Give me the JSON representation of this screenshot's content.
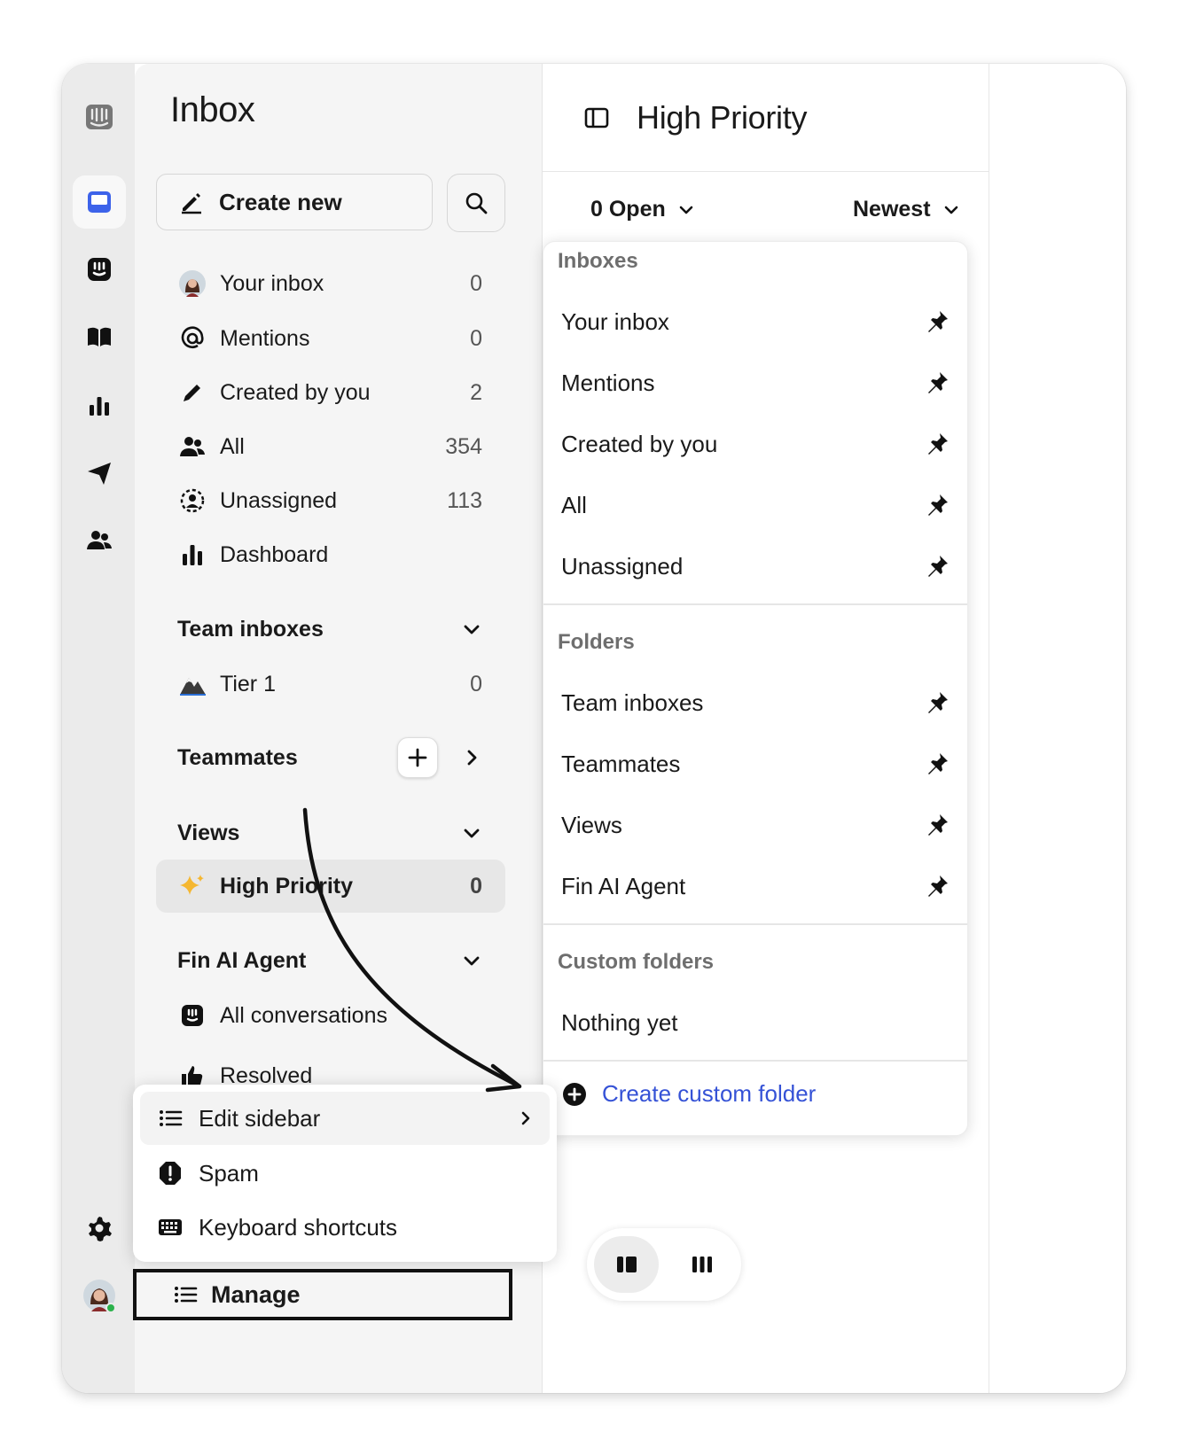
{
  "sidebar": {
    "title": "Inbox",
    "create_label": "Create new",
    "items": [
      {
        "label": "Your inbox",
        "count": "0"
      },
      {
        "label": "Mentions",
        "count": "0"
      },
      {
        "label": "Created by you",
        "count": "2"
      },
      {
        "label": "All",
        "count": "354"
      },
      {
        "label": "Unassigned",
        "count": "113"
      },
      {
        "label": "Dashboard",
        "count": ""
      }
    ],
    "team_inboxes": {
      "title": "Team inboxes",
      "items": [
        {
          "label": "Tier 1",
          "count": "0"
        }
      ]
    },
    "teammates": {
      "title": "Teammates"
    },
    "views": {
      "title": "Views",
      "items": [
        {
          "label": "High Priority",
          "count": "0"
        }
      ]
    },
    "fin": {
      "title": "Fin AI Agent",
      "items": [
        {
          "label": "All conversations"
        },
        {
          "label": "Resolved"
        }
      ]
    }
  },
  "manage_menu": {
    "items": [
      {
        "label": "Edit sidebar",
        "icon": "list-icon"
      },
      {
        "label": "Spam",
        "icon": "spam-icon"
      },
      {
        "label": "Keyboard shortcuts",
        "icon": "keyboard-icon"
      }
    ],
    "manage_label": "Manage"
  },
  "main": {
    "title": "High Priority",
    "status_filter": "0 Open",
    "sort_filter": "Newest"
  },
  "dropdown": {
    "inboxes_header": "Inboxes",
    "inboxes": [
      "Your inbox",
      "Mentions",
      "Created by you",
      "All",
      "Unassigned"
    ],
    "folders_header": "Folders",
    "folders": [
      "Team inboxes",
      "Teammates",
      "Views",
      "Fin AI Agent"
    ],
    "custom_header": "Custom folders",
    "custom_empty": "Nothing yet",
    "create_label": "Create custom folder"
  },
  "colors": {
    "accent": "#3552d6",
    "rail_active": "#3d63ea",
    "presence": "#2bb24c"
  }
}
